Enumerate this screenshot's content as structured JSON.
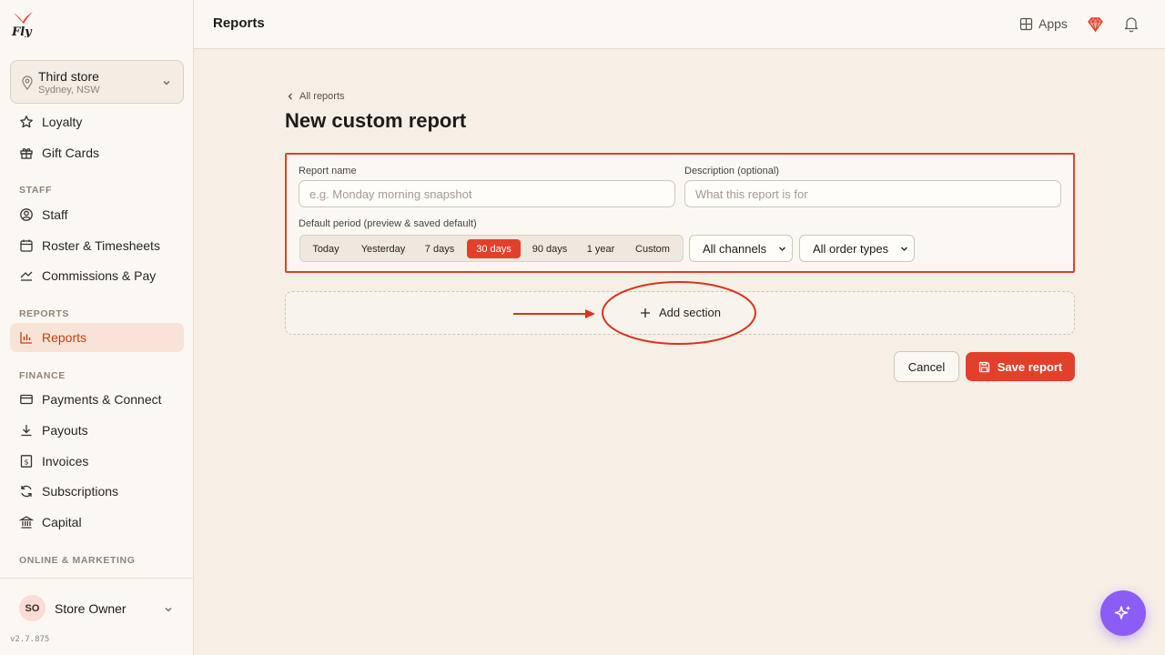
{
  "sidebar": {
    "store": {
      "name": "Third store",
      "location": "Sydney, NSW"
    },
    "items_top": [
      {
        "label": "Loyalty",
        "icon": "star-icon"
      },
      {
        "label": "Gift Cards",
        "icon": "gift-icon"
      }
    ],
    "sections": {
      "staff": "STAFF",
      "reports": "REPORTS",
      "finance": "FINANCE",
      "online": "ONLINE & MARKETING"
    },
    "staff_items": [
      {
        "label": "Staff",
        "icon": "user-circle-icon"
      },
      {
        "label": "Roster & Timesheets",
        "icon": "calendar-icon"
      },
      {
        "label": "Commissions & Pay",
        "icon": "percent-icon"
      }
    ],
    "reports_items": [
      {
        "label": "Reports",
        "icon": "bar-chart-icon",
        "active": true
      }
    ],
    "finance_items": [
      {
        "label": "Payments & Connect",
        "icon": "credit-card-icon"
      },
      {
        "label": "Payouts",
        "icon": "download-icon"
      },
      {
        "label": "Invoices",
        "icon": "dollar-doc-icon"
      },
      {
        "label": "Subscriptions",
        "icon": "refresh-icon"
      },
      {
        "label": "Capital",
        "icon": "bank-icon"
      }
    ],
    "user": {
      "initials": "SO",
      "name": "Store Owner"
    },
    "version": "v2.7.875"
  },
  "topbar": {
    "title": "Reports",
    "apps_label": "Apps"
  },
  "main": {
    "breadcrumb": "All reports",
    "title": "New custom report",
    "form": {
      "report_name_label": "Report name",
      "report_name_placeholder": "e.g. Monday morning snapshot",
      "description_label": "Description (optional)",
      "description_placeholder": "What this report is for",
      "period_label": "Default period (preview & saved default)",
      "periods": [
        "Today",
        "Yesterday",
        "7 days",
        "30 days",
        "90 days",
        "1 year",
        "Custom"
      ],
      "selected_period": "30 days",
      "channel_select": "All channels",
      "order_type_select": "All order types"
    },
    "add_section_label": "Add section",
    "cancel_label": "Cancel",
    "save_label": "Save report"
  },
  "colors": {
    "accent": "#e3402b",
    "active_nav_bg": "#f9e3d8",
    "fab": "#8b5cf6",
    "background": "#f5efe6"
  }
}
